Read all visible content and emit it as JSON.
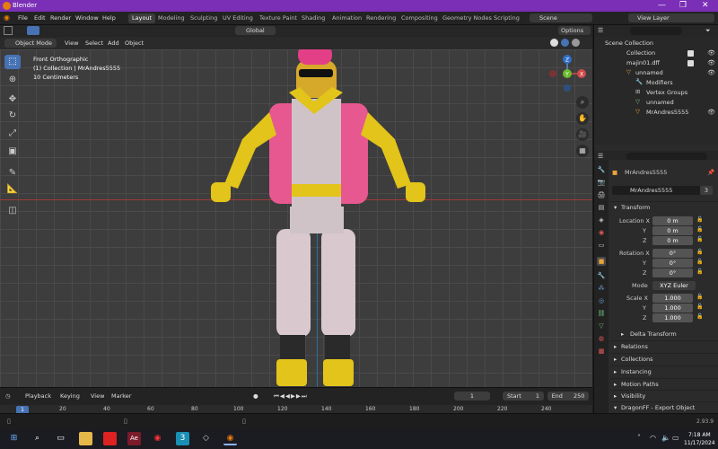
{
  "window": {
    "title": "Blender",
    "controls": [
      "—",
      "❐",
      "✕"
    ]
  },
  "menus": [
    "File",
    "Edit",
    "Render",
    "Window",
    "Help"
  ],
  "workspaces": [
    "Layout",
    "Modeling",
    "Sculpting",
    "UV Editing",
    "Texture Paint",
    "Shading",
    "Animation",
    "Rendering",
    "Compositing",
    "Geometry Nodes",
    "Scripting"
  ],
  "active_workspace": "Layout",
  "scene": {
    "label": "Scene",
    "view_layer": "View Layer"
  },
  "toolheader": {
    "orientation": "Global",
    "options": "Options"
  },
  "viewport_header": {
    "mode": "Object Mode",
    "menus": [
      "View",
      "Select",
      "Add",
      "Object"
    ]
  },
  "viewport_overlay": {
    "line1": "Front Orthographic",
    "line2": "(1) Collection | MrAndres5555",
    "line3": "10 Centimeters"
  },
  "gizmo": {
    "z": "Z",
    "y": "Y",
    "x": "X"
  },
  "outliner": {
    "rows": [
      {
        "label": "Scene Collection",
        "indent": 0
      },
      {
        "label": "Collection",
        "indent": 1
      },
      {
        "label": "majin01.dff",
        "indent": 1
      },
      {
        "label": "unnamed",
        "indent": 2
      },
      {
        "label": "Modifiers",
        "indent": 3
      },
      {
        "label": "Vertex Groups",
        "indent": 3
      },
      {
        "label": "unnamed",
        "indent": 3
      },
      {
        "label": "MrAndres5555",
        "indent": 2
      }
    ]
  },
  "properties": {
    "object_name": "MrAndres5555",
    "data_name": "MrAndres5555",
    "users": "3",
    "transform_title": "Transform",
    "location": {
      "label": "Location X",
      "values": [
        "0 m",
        "0 m",
        "0 m"
      ]
    },
    "rotation": {
      "label": "Rotation X",
      "values": [
        "0°",
        "0°",
        "0°"
      ]
    },
    "mode": {
      "label": "Mode",
      "value": "XYZ Euler"
    },
    "scale": {
      "label": "Scale X",
      "values": [
        "1.000",
        "1.000",
        "1.000"
      ]
    },
    "axis_labels": [
      "Y",
      "Z"
    ],
    "delta": "Delta Transform",
    "sections": [
      "Relations",
      "Collections",
      "Instancing",
      "Motion Paths",
      "Visibility",
      "DragonFF - Export Object"
    ]
  },
  "timeline": {
    "menus": [
      "Playback",
      "Keying",
      "View",
      "Marker"
    ],
    "current_frame": "1",
    "start_label": "Start",
    "start": "1",
    "end_label": "End",
    "end": "250",
    "ticks": [
      "20",
      "40",
      "60",
      "80",
      "100",
      "120",
      "140",
      "160",
      "180",
      "200",
      "220",
      "240"
    ],
    "frame_indicator": "1"
  },
  "status": {
    "version": "2.93.9"
  },
  "taskbar": {
    "time": "7:18 AM",
    "date": "11/17/2024"
  },
  "colors": {
    "accent": "#4772b3",
    "titlebar": "#7a2fb6",
    "x_axis": "#a03a3a",
    "y_axis": "#2f6f9e"
  }
}
